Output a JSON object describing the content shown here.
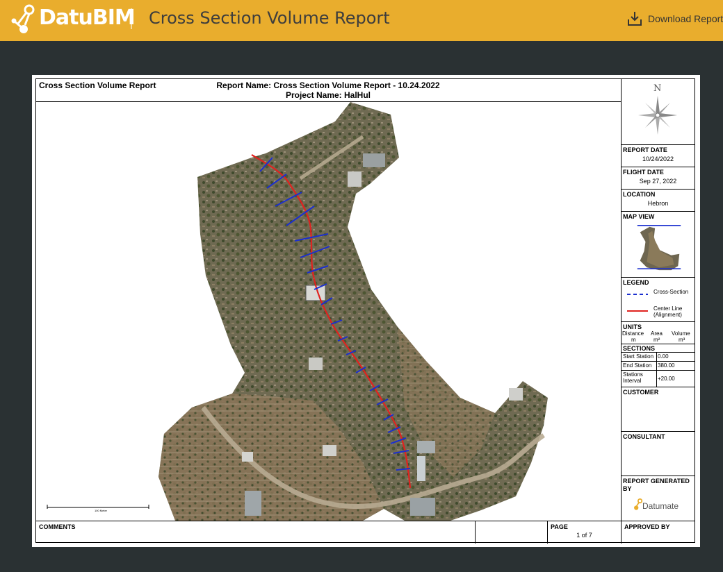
{
  "header": {
    "brand": "DatuBIM",
    "title": "Cross Section Volume Report",
    "download_label": "Download Report",
    "colors": {
      "bar": "#e9ad2d",
      "brand_text": "#ffffff"
    }
  },
  "report": {
    "left_title": "Cross Section Volume Report",
    "report_name": "Report Name: Cross Section Volume Report - 10.24.2022",
    "project_name": "Project Name: HalHul",
    "compass_letter": "N",
    "report_date_label": "REPORT DATE",
    "report_date": "10/24/2022",
    "flight_date_label": "FLIGHT DATE",
    "flight_date": "Sep 27, 2022",
    "location_label": "LOCATION",
    "location": "Hebron",
    "map_view_label": "MAP VIEW",
    "legend_label": "LEGEND",
    "legend_cross": "Cross-Section",
    "legend_center": "Center Line (Alignment)",
    "units_label": "UNITS",
    "units_distance": "Distance",
    "units_area": "Area",
    "units_volume": "Volume",
    "unit_m": "m",
    "unit_m2": "m²",
    "unit_m3": "m³",
    "sections_label": "SECTIONS",
    "start_station_label": "Start Station",
    "start_station": "0.00",
    "end_station_label": "End Station",
    "end_station": "380.00",
    "interval_label": "Stations Interval",
    "interval": "+20.00",
    "customer_label": "CUSTOMER",
    "consultant_label": "CONSULTANT",
    "generated_by_label": "REPORT GENERATED BY",
    "datumate_logo": "Datumate",
    "comments_label": "COMMENTS",
    "page_label": "PAGE",
    "page_value": "1 of 7",
    "approved_label": "APPROVED BY",
    "scale_label": "100 Meter"
  }
}
